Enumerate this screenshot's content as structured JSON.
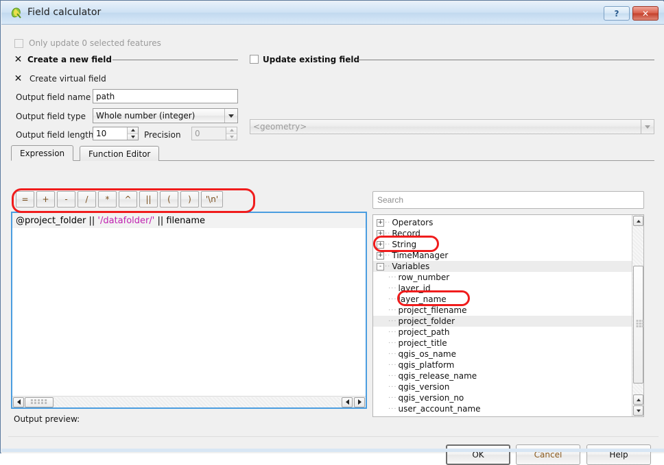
{
  "window": {
    "title": "Field calculator",
    "icon": "qgis-logo-icon",
    "help_button": "?",
    "close_button": "✕"
  },
  "options": {
    "only_update_selected": {
      "label": "Only update 0 selected features",
      "checked": false,
      "enabled": false
    },
    "create_new_field": {
      "label": "Create a new field",
      "checked": true
    },
    "create_virtual_field": {
      "label": "Create virtual field",
      "checked": true
    },
    "update_existing_field": {
      "label": "Update existing field",
      "checked": false
    }
  },
  "form": {
    "output_field_name_label": "Output field name",
    "output_field_name_value": "path",
    "output_field_type_label": "Output field type",
    "output_field_type_value": "Whole number (integer)",
    "output_field_length_label": "Output field length",
    "output_field_length_value": "10",
    "precision_label": "Precision",
    "precision_value": "0",
    "existing_field_value": "<geometry>"
  },
  "tabs": [
    {
      "label": "Expression",
      "active": true
    },
    {
      "label": "Function Editor",
      "active": false
    }
  ],
  "operators": [
    "=",
    "+",
    "-",
    "/",
    "*",
    "^",
    "||",
    "(",
    ")",
    "'\\n'"
  ],
  "expression": {
    "part1": "@project_folder || ",
    "literal": "'/datafolder/'",
    "part2": " || filename",
    "full": "@project_folder || '/datafolder/' || filename",
    "literal_color": "#c020b0"
  },
  "search": {
    "placeholder": "Search",
    "value": ""
  },
  "tree": [
    {
      "label": "Operators",
      "level": 0,
      "node": "+",
      "selected": false
    },
    {
      "label": "Record",
      "level": 0,
      "node": "+",
      "selected": false
    },
    {
      "label": "String",
      "level": 0,
      "node": "+",
      "selected": false
    },
    {
      "label": "TimeManager",
      "level": 0,
      "node": "+",
      "selected": false
    },
    {
      "label": "Variables",
      "level": 0,
      "node": "-",
      "selected": true
    },
    {
      "label": "row_number",
      "level": 1,
      "node": "",
      "selected": false
    },
    {
      "label": "layer_id",
      "level": 1,
      "node": "",
      "selected": false
    },
    {
      "label": "layer_name",
      "level": 1,
      "node": "",
      "selected": false
    },
    {
      "label": "project_filename",
      "level": 1,
      "node": "",
      "selected": false
    },
    {
      "label": "project_folder",
      "level": 1,
      "node": "",
      "selected": true
    },
    {
      "label": "project_path",
      "level": 1,
      "node": "",
      "selected": false
    },
    {
      "label": "project_title",
      "level": 1,
      "node": "",
      "selected": false
    },
    {
      "label": "qgis_os_name",
      "level": 1,
      "node": "",
      "selected": false
    },
    {
      "label": "qgis_platform",
      "level": 1,
      "node": "",
      "selected": false
    },
    {
      "label": "qgis_release_name",
      "level": 1,
      "node": "",
      "selected": false
    },
    {
      "label": "qgis_version",
      "level": 1,
      "node": "",
      "selected": false
    },
    {
      "label": "qgis_version_no",
      "level": 1,
      "node": "",
      "selected": false
    },
    {
      "label": "user_account_name",
      "level": 1,
      "node": "",
      "selected": false
    }
  ],
  "footer": {
    "output_preview_label": "Output preview:",
    "output_preview_value": ""
  },
  "buttons": {
    "ok": "OK",
    "cancel": "Cancel",
    "help": "Help"
  },
  "annotations": [
    {
      "name": "expression-highlight"
    },
    {
      "name": "variables-node-highlight"
    },
    {
      "name": "project-folder-highlight"
    }
  ],
  "colors": {
    "accent": "#4a9de0",
    "annotation": "#f01c1c",
    "titlebar": "#cfe2f4",
    "close": "#c4402c"
  }
}
